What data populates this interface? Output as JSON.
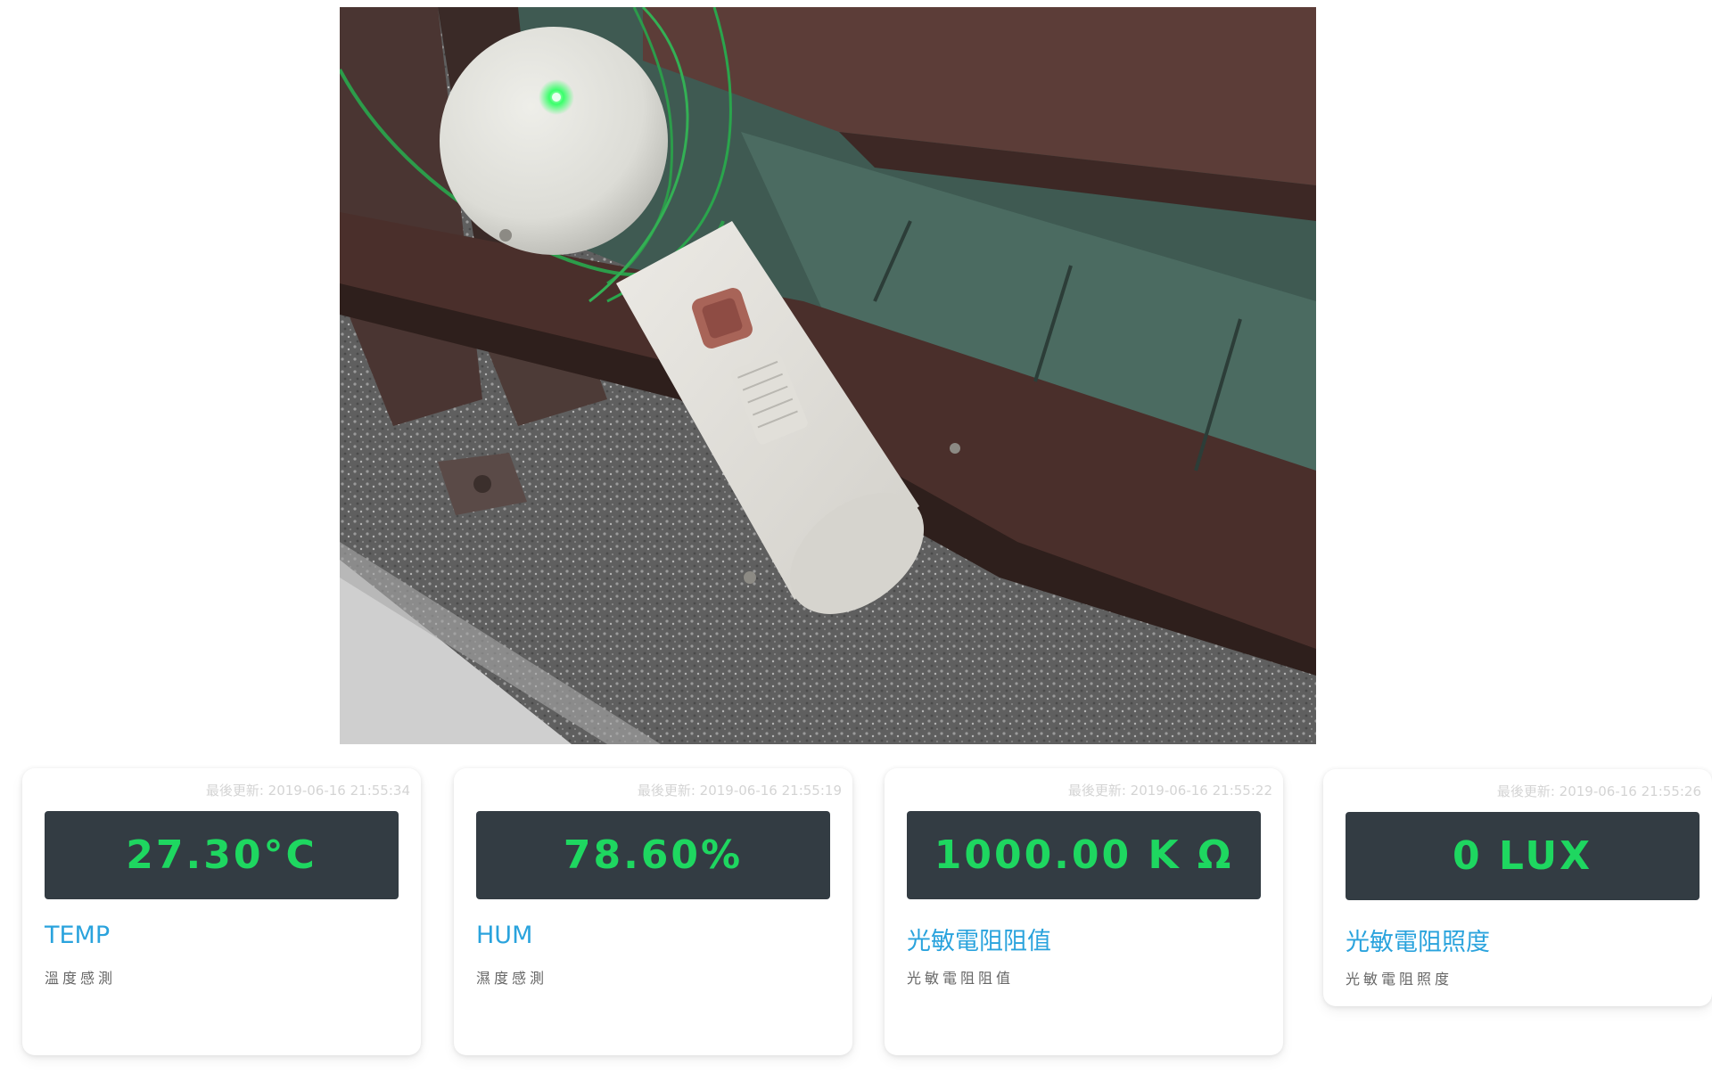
{
  "photo": {
    "subject": "white 3D-printed sensor enclosure hanging on railing with green indicator LED"
  },
  "cards": [
    {
      "updated": "最後更新: 2019-06-16 21:55:34",
      "value": "27.30°C",
      "title": "TEMP",
      "desc": "溫度感測"
    },
    {
      "updated": "最後更新: 2019-06-16 21:55:19",
      "value": "78.60%",
      "title": "HUM",
      "desc": "濕度感測"
    },
    {
      "updated": "最後更新: 2019-06-16 21:55:22",
      "value": "1000.00 K Ω",
      "title": "光敏電阻阻值",
      "desc": "光敏電阻阻值"
    },
    {
      "updated": "最後更新: 2019-06-16 21:55:26",
      "value": "0 LUX",
      "title": "光敏電阻照度",
      "desc": "光敏電阻照度"
    }
  ],
  "colors": {
    "value_text": "#1ed760",
    "display_bg": "#333c43",
    "title_text": "#2aa3dd",
    "led": "#39ff6a"
  }
}
